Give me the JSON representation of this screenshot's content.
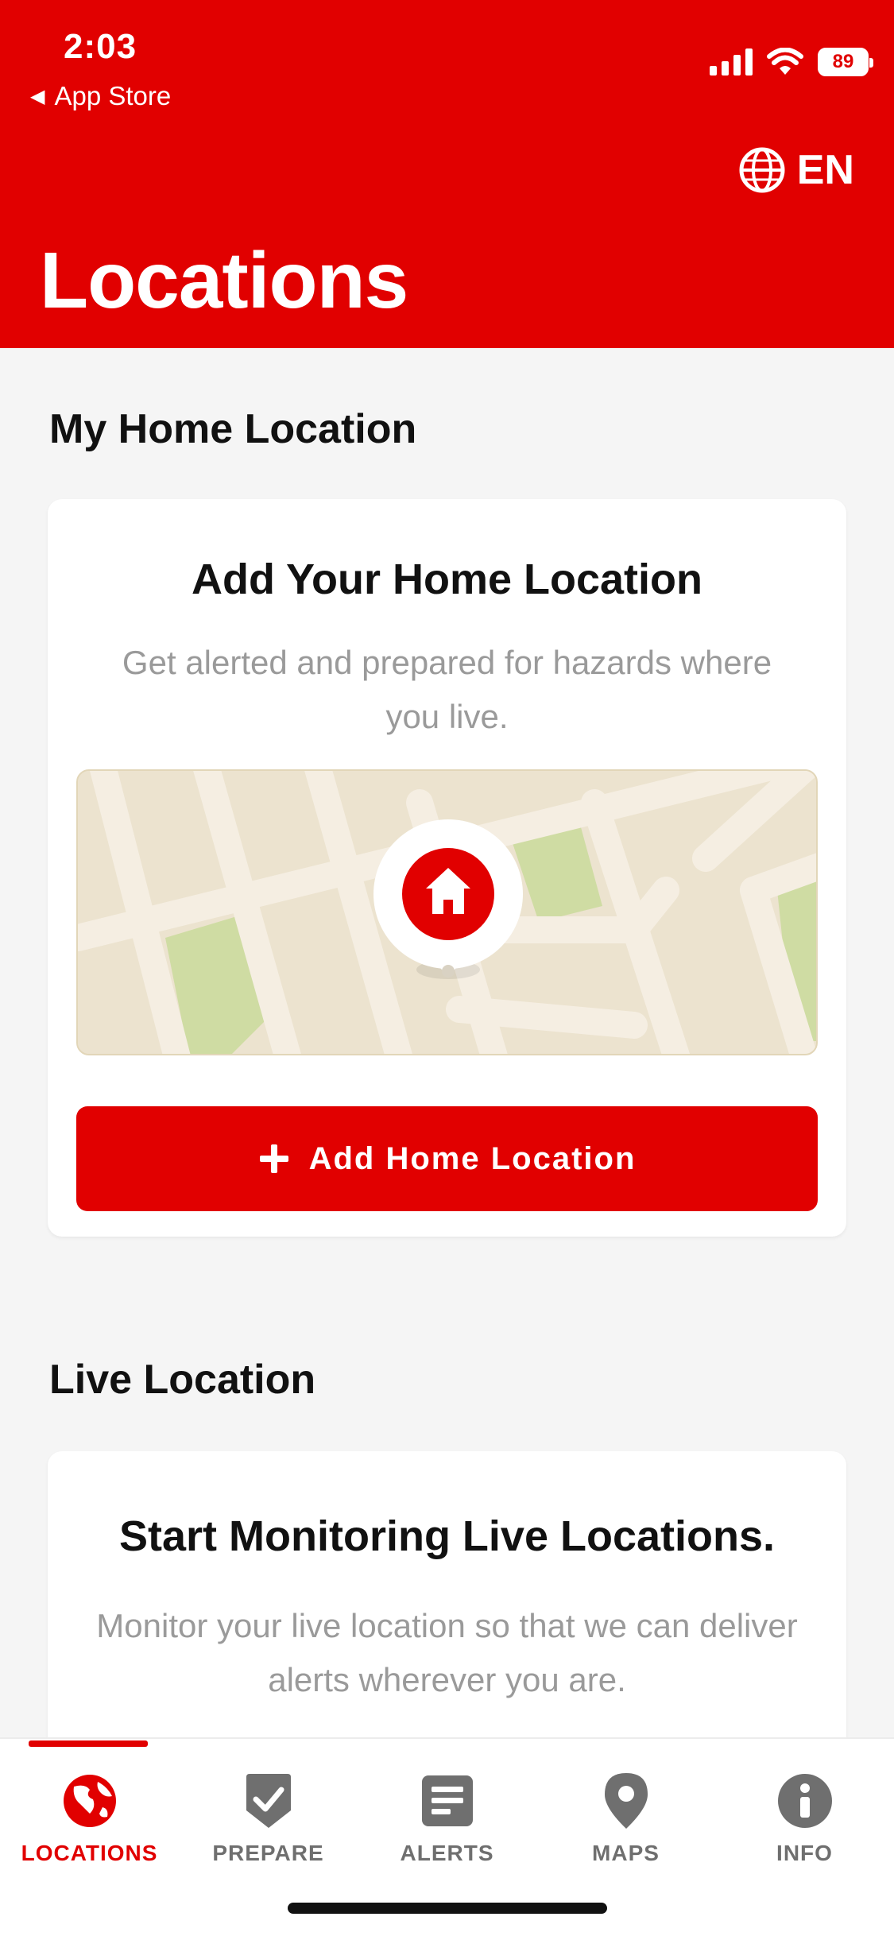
{
  "status_bar": {
    "time": "2:03",
    "back_label": "App Store",
    "battery": "89"
  },
  "header": {
    "language": "EN",
    "title": "Locations"
  },
  "home_section": {
    "title": "My Home Location",
    "card_title": "Add Your Home Location",
    "card_subtitle": "Get alerted and prepared for hazards where you live.",
    "button_label": "Add Home Location"
  },
  "live_section": {
    "title": "Live Location",
    "card_title": "Start Monitoring Live Locations.",
    "card_subtitle": "Monitor your live location so that we can deliver alerts wherever you are."
  },
  "tabs": [
    {
      "label": "LOCATIONS",
      "icon": "globe-icon",
      "active": true
    },
    {
      "label": "PREPARE",
      "icon": "check-shield-icon",
      "active": false
    },
    {
      "label": "ALERTS",
      "icon": "alerts-doc-icon",
      "active": false
    },
    {
      "label": "MAPS",
      "icon": "map-pin-icon",
      "active": false
    },
    {
      "label": "INFO",
      "icon": "info-icon",
      "active": false
    }
  ],
  "colors": {
    "brand_red": "#e10000",
    "background": "#f5f5f5",
    "muted_text": "#9a9a9a",
    "tab_inactive": "#6f6f6f"
  }
}
